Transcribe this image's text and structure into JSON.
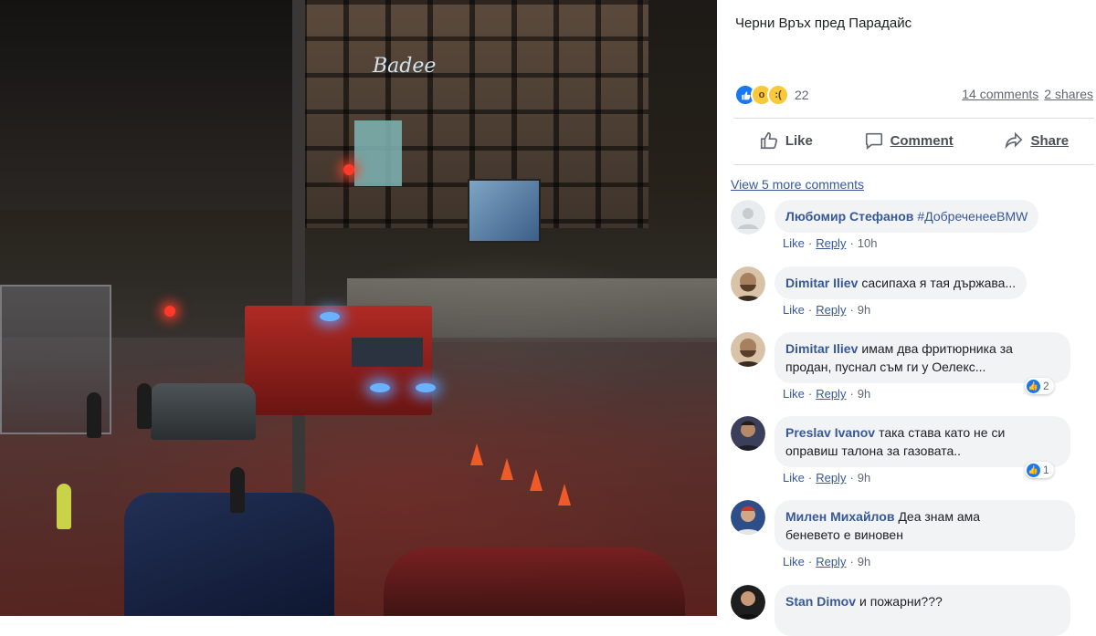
{
  "post": {
    "caption": "Черни Връх пред Парадайс",
    "reaction_count": "22",
    "comments_count": "14 comments",
    "shares_count": "2 shares",
    "actions": {
      "like": "Like",
      "comment": "Comment",
      "share": "Share"
    },
    "view_more": "View 5 more comments"
  },
  "photo": {
    "brand_sign": "Badee"
  },
  "comments": [
    {
      "author": "Любомир Стефанов",
      "text": "#ДобреченееBMW",
      "like": "Like",
      "reply": "Reply",
      "time": "10h",
      "avatar_color": "#e9ecef"
    },
    {
      "author": "Dimitar Iliev",
      "text": "сасипаха я тая държава...",
      "like": "Like",
      "reply": "Reply",
      "time": "9h",
      "avatar_color": "#7a5a44"
    },
    {
      "author": "Dimitar Iliev",
      "text": "имам два фритюрника за",
      "text2": "продан, пуснал съм ги у Оелекс...",
      "like": "Like",
      "reply": "Reply",
      "time": "9h",
      "likes": "2",
      "avatar_color": "#7a5a44"
    },
    {
      "author": "Preslav Ivanov",
      "text": "така става като не си",
      "text2": "оправиш талона за газовата..",
      "like": "Like",
      "reply": "Reply",
      "time": "9h",
      "likes": "1",
      "avatar_color": "#3b3f5c"
    },
    {
      "author": "Милен Михайлов",
      "text": "Деа знам ама",
      "text2": "беневето е виновен",
      "like": "Like",
      "reply": "Reply",
      "time": "9h",
      "avatar_color": "#2e4e8a"
    },
    {
      "author": "Stan Dimov",
      "text": "и пожарни???",
      "avatar_color": "#1e1e1e"
    }
  ],
  "colors": {
    "link": "#385898",
    "bubble": "#f2f3f5",
    "like_blue": "#1877f2"
  }
}
